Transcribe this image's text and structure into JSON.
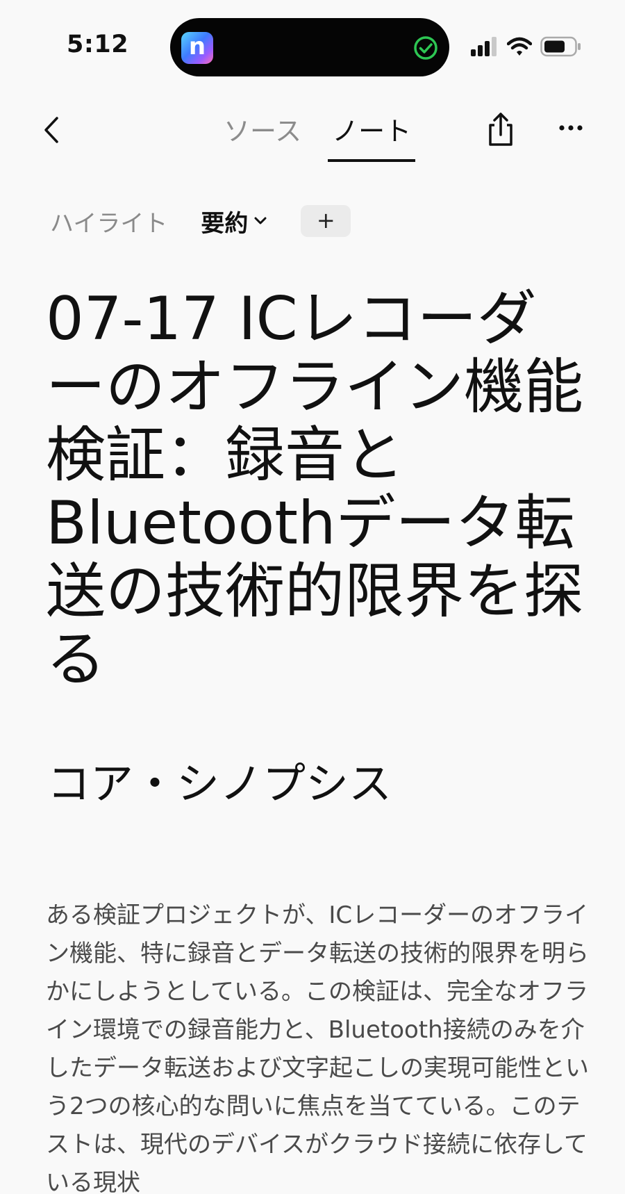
{
  "status_bar": {
    "time": "5:12",
    "island_app_letter": "n",
    "colors": {
      "check": "#2dc653",
      "island": "#050505"
    }
  },
  "nav": {
    "tabs": [
      {
        "label": "ソース",
        "active": false
      },
      {
        "label": "ノート",
        "active": true
      }
    ]
  },
  "toolbar": {
    "highlight_label": "ハイライト",
    "summary_label": "要約",
    "add_label": "+"
  },
  "content": {
    "title": "07-17 ICレコーダーのオフライン機能検証：録音とBluetoothデータ転送の技術的限界を探る",
    "section_heading": "コア・シノプシス",
    "body": "ある検証プロジェクトが、ICレコーダーのオフライン機能、特に録音とデータ転送の技術的限界を明らかにしようとしている。この検証は、完全なオフライン環境での録音能力と、Bluetooth接続のみを介したデータ転送および文字起こしの実現可能性という2つの核心的な問いに焦点を当てている。このテストは、現代のデバイスがクラウド接続に依存している現状"
  }
}
